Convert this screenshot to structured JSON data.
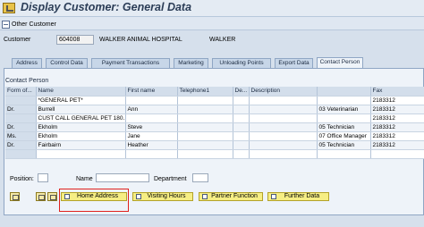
{
  "window": {
    "title": "Display Customer: General Data"
  },
  "toolbar": {
    "other_customer": "Other Customer"
  },
  "customer": {
    "label": "Customer",
    "id": "604008",
    "name": "WALKER ANIMAL HOSPITAL",
    "search_term": "WALKER"
  },
  "tabs": [
    {
      "label": "Address",
      "active": false
    },
    {
      "label": "Control Data",
      "active": false
    },
    {
      "label": "Payment Transactions",
      "active": false
    },
    {
      "label": "Marketing",
      "active": false
    },
    {
      "label": "Unloading Points",
      "active": false
    },
    {
      "label": "Export Data",
      "active": false
    },
    {
      "label": "Contact Person",
      "active": true
    }
  ],
  "contact_section": {
    "title": "Contact Person"
  },
  "table": {
    "columns": [
      "Form of...",
      "Name",
      "First name",
      "Telephone1",
      "De...",
      "Description",
      "",
      "Fax"
    ],
    "rows": [
      [
        "",
        "*GENERAL PET*",
        "",
        "",
        "",
        "",
        "",
        "2183312"
      ],
      [
        "Dr.",
        "Burrell",
        "Ann",
        "",
        "",
        "",
        "03 Veterinarian",
        "2183312"
      ],
      [
        "",
        "CUST CALL GENERAL PET 180...",
        "",
        "",
        "",
        "",
        "",
        "2183312"
      ],
      [
        "Dr.",
        "Ekholm",
        "Steve",
        "",
        "",
        "",
        "05 Technician",
        "2183312"
      ],
      [
        "Ms.",
        "Ekholm",
        "Jane",
        "",
        "",
        "",
        "07 Office Manager",
        "2183312"
      ],
      [
        "Dr.",
        "Fairbairn",
        "Heather",
        "",
        "",
        "",
        "05 Technician",
        "2183312"
      ],
      [
        "",
        "",
        "",
        "",
        "",
        "",
        "",
        ""
      ]
    ]
  },
  "position_bar": {
    "position_label": "Position:",
    "name_label": "Name",
    "department_label": "Department"
  },
  "actions": {
    "home_address": "Home Address",
    "visiting_hours": "Visiting Hours",
    "partner_function": "Partner Function",
    "further_data": "Further Data"
  },
  "colors": {
    "highlight": "#e0221f",
    "action_bg": "#f6ee84",
    "title": "#2b3d57"
  }
}
